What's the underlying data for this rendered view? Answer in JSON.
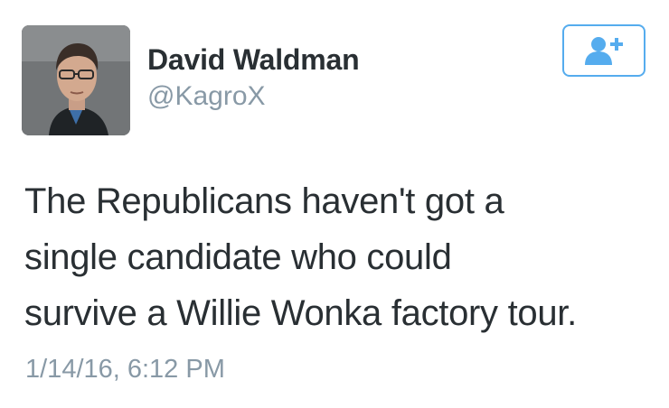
{
  "tweet": {
    "author": {
      "display_name": "David Waldman",
      "handle": "@KagroX",
      "avatar_icon": "profile-photo"
    },
    "follow_button": {
      "icon": "follow-user-icon",
      "accent_color": "#55acee"
    },
    "text_lines": [
      "The Republicans haven't got a",
      "single candidate who could",
      "survive a Willie Wonka factory tour."
    ],
    "timestamp": "1/14/16, 6:12 PM"
  }
}
